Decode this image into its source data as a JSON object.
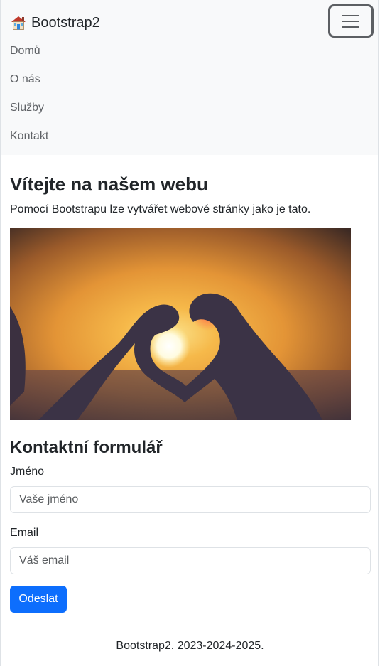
{
  "navbar": {
    "brand": "Bootstrap2",
    "brand_icon": "house-icon",
    "toggler_icon": "hamburger-menu-icon",
    "items": [
      {
        "label": "Domů"
      },
      {
        "label": "O nás"
      },
      {
        "label": "Služby"
      },
      {
        "label": "Kontakt"
      }
    ]
  },
  "hero": {
    "title": "Vítejte na našem webu",
    "text": "Pomocí Bootstrapu lze vytvářet webové stránky jako je tato.",
    "image": "sunset-heart-hands-photo"
  },
  "form": {
    "title": "Kontaktní formulář",
    "name_label": "Jméno",
    "name_placeholder": "Vaše jméno",
    "email_label": "Email",
    "email_placeholder": "Váš email",
    "submit_label": "Odeslat"
  },
  "footer": {
    "text": "Bootstrap2. 2023-2024-2025."
  },
  "colors": {
    "navbar_bg": "#f8f9fa",
    "primary": "#0d6efd",
    "text": "#212529",
    "nav_link": "#5f6266",
    "border": "#dee2e6"
  }
}
